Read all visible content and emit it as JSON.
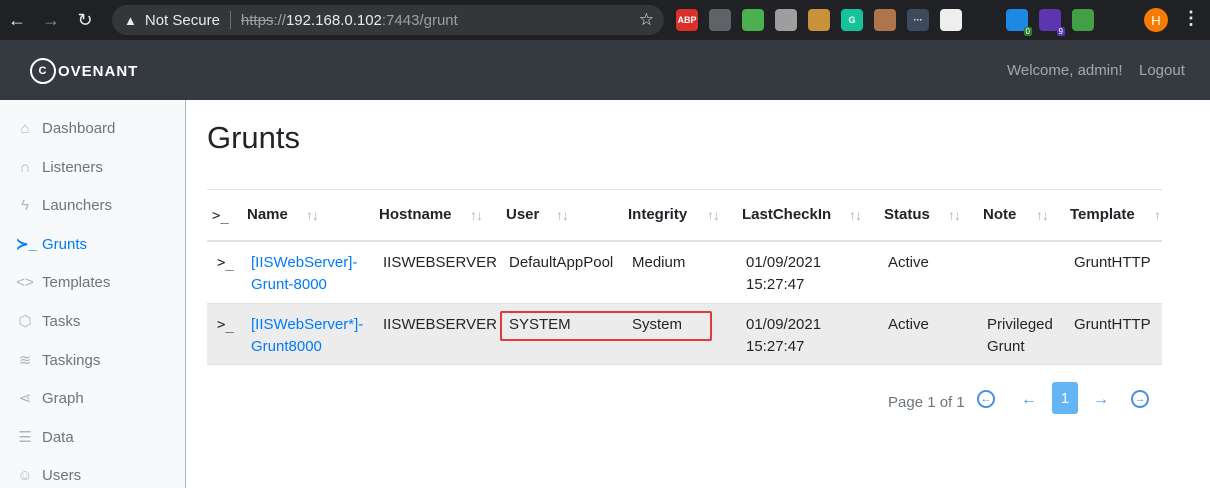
{
  "browser": {
    "security_label": "Not Secure",
    "url_protocol": "https",
    "url_sep": "://",
    "url_host": "192.168.0.102",
    "url_rest": ":7443/grunt",
    "profile_initial": "H",
    "extensions": [
      {
        "name": "adblock-plus-icon",
        "label": "ABP",
        "color": "#d9302c",
        "badge": ""
      },
      {
        "name": "extension-icon",
        "label": "",
        "color": "#5f6368",
        "badge": ""
      },
      {
        "name": "shield-extension-icon",
        "label": "",
        "color": "#4caf50",
        "badge": ""
      },
      {
        "name": "briefcase-extension-icon",
        "label": "",
        "color": "#9e9e9e",
        "badge": ""
      },
      {
        "name": "cookie-extension-icon",
        "label": "",
        "color": "#c8913b",
        "badge": ""
      },
      {
        "name": "grammarly-icon",
        "label": "G",
        "color": "#15c39a",
        "badge": ""
      },
      {
        "name": "cookie-editor-icon",
        "label": "",
        "color": "#b0744a",
        "badge": ""
      },
      {
        "name": "dots-extension-icon",
        "label": "···",
        "color": "#3c4a5c",
        "badge": ""
      },
      {
        "name": "spy-extension-icon",
        "label": "",
        "color": "#eeeeee",
        "badge": ""
      },
      {
        "name": "react-devtools-icon",
        "label": "",
        "color": "#202124",
        "badge": ""
      },
      {
        "name": "proxy-extension-icon",
        "label": "",
        "color": "#1e88e5",
        "badge": "0"
      },
      {
        "name": "hexagon-extension-icon",
        "label": "",
        "color": "#5e35b1",
        "badge": "9"
      },
      {
        "name": "camera-extension-icon",
        "label": "",
        "color": "#43a047",
        "badge": ""
      },
      {
        "name": "puzzle-extensions-icon",
        "label": "",
        "color": "#202124",
        "badge": ""
      }
    ]
  },
  "header": {
    "brand": "OVENANT",
    "welcome": "Welcome, admin!",
    "logout": "Logout"
  },
  "sidebar": {
    "items": [
      {
        "label": "Dashboard",
        "icon": "home-icon",
        "glyph": "⌂",
        "active": false
      },
      {
        "label": "Listeners",
        "icon": "headphones-icon",
        "glyph": "∩",
        "active": false
      },
      {
        "label": "Launchers",
        "icon": "zap-icon",
        "glyph": "ϟ",
        "active": false
      },
      {
        "label": "Grunts",
        "icon": "terminal-icon",
        "glyph": "≻_",
        "active": true
      },
      {
        "label": "Templates",
        "icon": "code-icon",
        "glyph": "<>",
        "active": false
      },
      {
        "label": "Tasks",
        "icon": "box-icon",
        "glyph": "⬡",
        "active": false
      },
      {
        "label": "Taskings",
        "icon": "layers-icon",
        "glyph": "≋",
        "active": false
      },
      {
        "label": "Graph",
        "icon": "share-icon",
        "glyph": "⋖",
        "active": false
      },
      {
        "label": "Data",
        "icon": "database-icon",
        "glyph": "☰",
        "active": false
      },
      {
        "label": "Users",
        "icon": "users-icon",
        "glyph": "☺",
        "active": false
      }
    ]
  },
  "main": {
    "title": "Grunts",
    "table": {
      "columns": [
        "Name",
        "Hostname",
        "User",
        "Integrity",
        "LastCheckIn",
        "Status",
        "Note",
        "Template"
      ],
      "rows": [
        {
          "name_line1": "[IISWebServer]-",
          "name_line2": "Grunt-8000",
          "hostname": "IISWEBSERVER",
          "user": "DefaultAppPool",
          "integrity": "Medium",
          "checkin_date": "01/09/2021",
          "checkin_time": "15:27:47",
          "status": "Active",
          "note_line1": "",
          "note_line2": "",
          "template": "GruntHTTP"
        },
        {
          "name_line1": "[IISWebServer*]-",
          "name_line2": "Grunt8000",
          "hostname": "IISWEBSERVER",
          "user": "SYSTEM",
          "integrity": "System",
          "checkin_date": "01/09/2021",
          "checkin_time": "15:27:47",
          "status": "Active",
          "note_line1": "Privileged",
          "note_line2": "Grunt",
          "template": "GruntHTTP"
        }
      ]
    },
    "pagination": {
      "label": "Page 1 of 1",
      "current_page": "1"
    }
  }
}
